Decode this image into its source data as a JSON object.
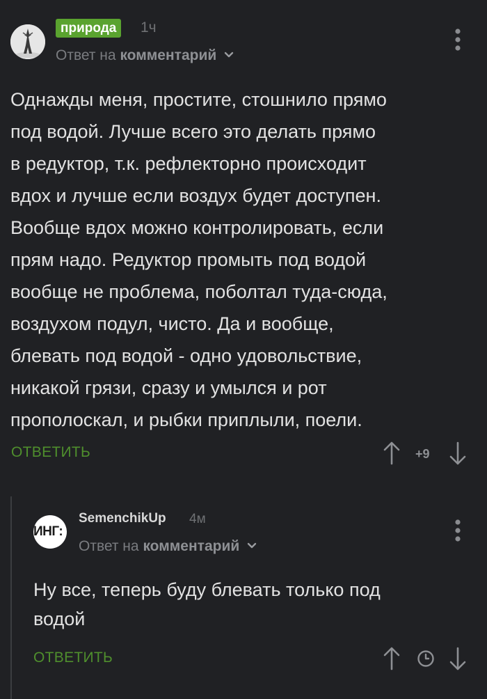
{
  "comments": [
    {
      "badge": "природа",
      "time": "1ч",
      "reply_prefix": "Ответ на",
      "reply_target": "комментарий",
      "lines": [
        "Однажды меня, простите, стошнило прямо",
        "под водой. Лучше всего это делать прямо",
        "в редуктор, т.к. рефлекторно происходит",
        "вдох и лучше если воздух будет доступен.",
        "Вообще вдох можно контролировать, если",
        "прям надо. Редуктор промыть под водой",
        "вообще не проблема, поболтал туда-сюда,",
        "воздухом подул, чисто. Да и вообще,",
        "блевать под водой - одно удовольствие,",
        "никакой грязи, сразу и умылся и рот",
        "прополоскал, и рыбки приплыли, поели."
      ],
      "answer_label": "ОТВЕТИТЬ",
      "score": "+9"
    },
    {
      "username": "SemenchikUp",
      "avatar_text": "ИНГ:",
      "time": "4м",
      "reply_prefix": "Ответ на",
      "reply_target": "комментарий",
      "lines": [
        "Ну все, теперь буду блевать только под",
        "водой"
      ],
      "answer_label": "ОТВЕТИТЬ"
    }
  ],
  "icons": {
    "more": "more-vertical-icon",
    "upvote": "arrow-up-icon",
    "downvote": "arrow-down-icon",
    "chevron": "chevron-down-icon",
    "pending": "clock-icon"
  },
  "colors": {
    "background": "#202124",
    "accent_green": "#5aa32f",
    "answer_green": "#4f8f2d",
    "muted_text": "#7a7c80"
  }
}
